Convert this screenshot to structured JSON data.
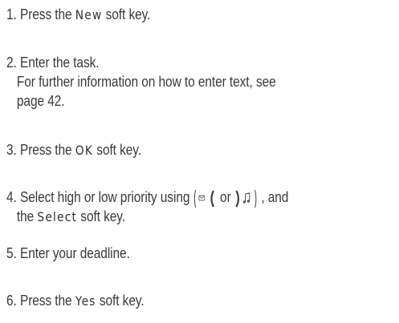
{
  "steps": [
    {
      "number": "1.",
      "before": "Press the",
      "softkey": "New",
      "after": "soft key."
    },
    {
      "number": "2.",
      "text": "Enter the task.",
      "note_line1": "For further information on how to enter text, see",
      "note_line2": "page 42."
    },
    {
      "number": "3.",
      "before": "Press the",
      "softkey": "OK",
      "after": "soft key."
    },
    {
      "number": "4.",
      "before": "Select high or low priority using",
      "icon_left": "up-volume-key-icon",
      "or": "or",
      "icon_right": "down-volume-key-icon",
      "after": ", and",
      "line2_before": "the",
      "softkey": "Select",
      "line2_after": "soft key."
    },
    {
      "number": "5.",
      "text": "Enter your deadline."
    },
    {
      "number": "6.",
      "before": "Press the",
      "softkey": "Yes",
      "after": "soft key."
    }
  ]
}
